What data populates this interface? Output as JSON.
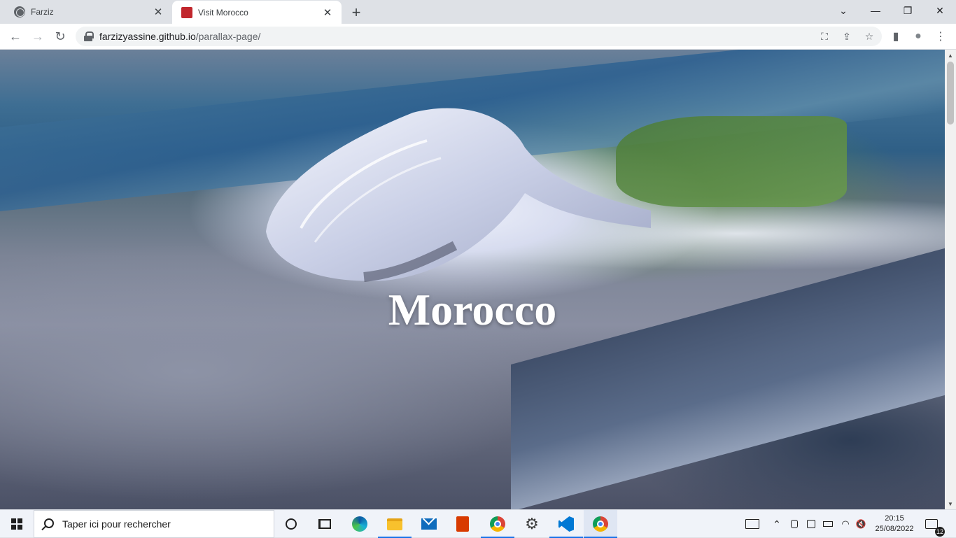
{
  "browser": {
    "tabs": [
      {
        "title": "Farziz",
        "favicon": "globe-icon",
        "active": false
      },
      {
        "title": "Visit Morocco",
        "favicon": "red-flag-icon",
        "active": true
      }
    ],
    "new_tab_symbol": "+",
    "window_controls": {
      "dropdown": "⌄",
      "minimize": "—",
      "restore": "❐",
      "close": "✕"
    },
    "tab_close_symbol": "✕",
    "address": {
      "host": "farzizyassine.github.io",
      "path": "/parallax-page/"
    },
    "nav": {
      "back": "←",
      "forward": "→",
      "reload": "↻"
    },
    "toolbar_icons": {
      "translate": "⛶",
      "share": "⇪",
      "bookmark": "☆",
      "sidepanel": "▮",
      "profile": "●",
      "menu": "⋮"
    }
  },
  "page": {
    "hero_title": "Morocco",
    "accent_color": "#c1272d"
  },
  "scrollbar": {
    "up": "▲",
    "down": "▼"
  },
  "taskbar": {
    "search_placeholder": "Taper ici pour rechercher",
    "apps": [
      "cortana",
      "task-view",
      "edge",
      "file-explorer",
      "mail",
      "office",
      "chrome",
      "settings",
      "vscode",
      "chrome"
    ],
    "tray": {
      "chevron": "⌃",
      "volume": "🔇"
    },
    "time": "20:15",
    "date": "25/08/2022",
    "notification_count": "12"
  }
}
